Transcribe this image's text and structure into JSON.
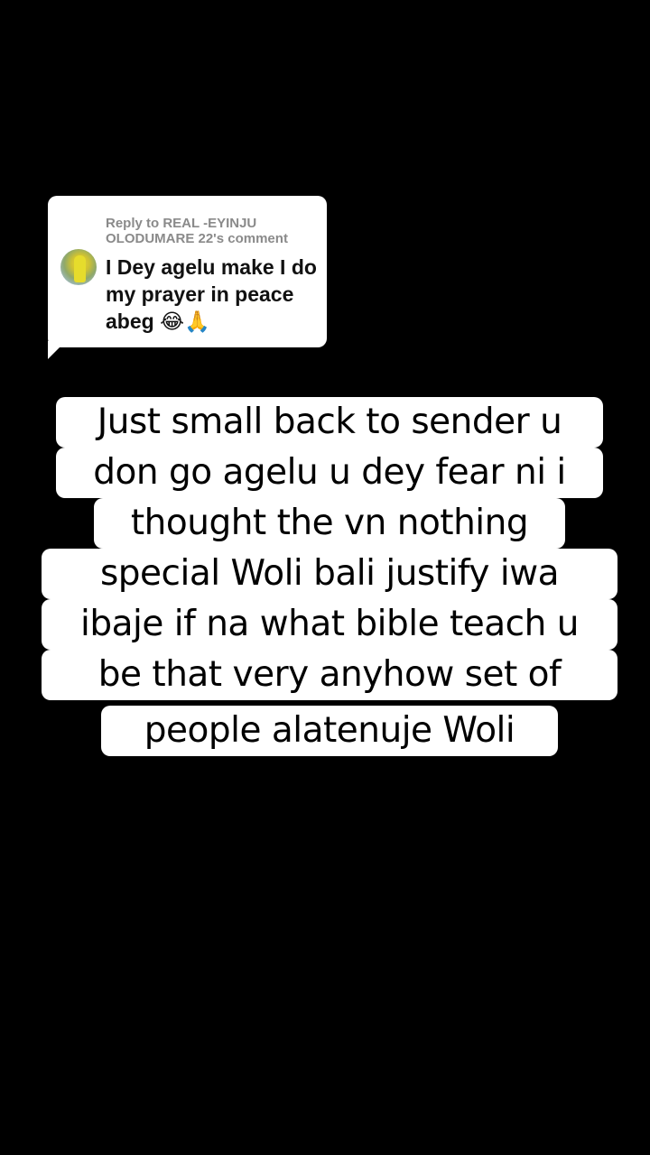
{
  "reply": {
    "header": "Reply to REAL -EYINJU OLODUMARE 22's comment",
    "comment": "I Dey agelu make I do my prayer in peace abeg 😂🙏"
  },
  "caption": {
    "lines": [
      "Just small back to sender u",
      "don go agelu u dey fear ni i",
      "thought the vn nothing",
      "special Woli bali justify iwa",
      "ibaje if na what bible teach u",
      "be that very anyhow set of",
      "people alatenuje Woli"
    ]
  }
}
